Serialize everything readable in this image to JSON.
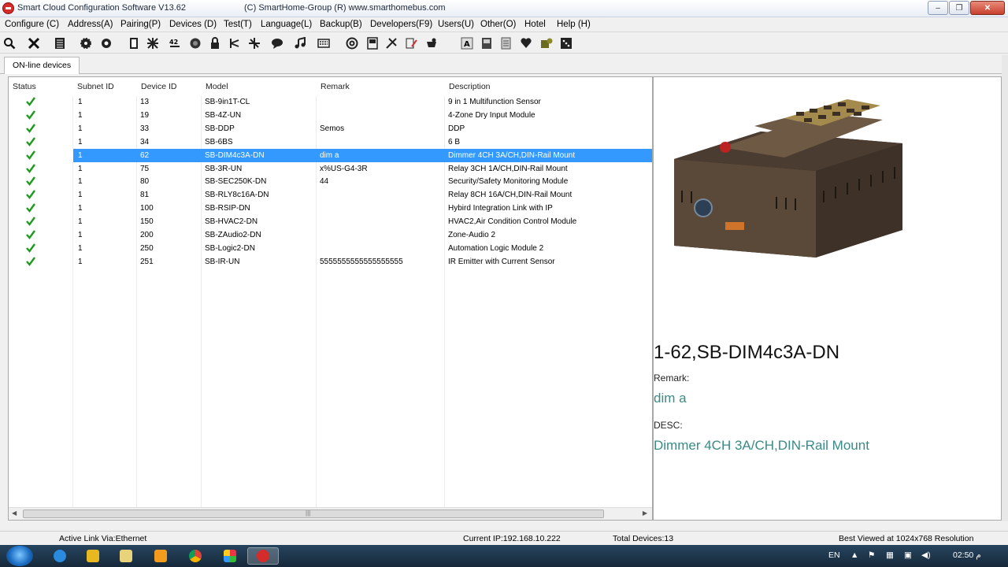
{
  "window": {
    "title": "Smart Cloud Configuration Software V13.62",
    "copyright": "(C) SmartHome-Group (R) www.smarthomebus.com",
    "minimize": "‒",
    "maximize": "❐",
    "close": "✕"
  },
  "menu": [
    {
      "label": "Configure (C)"
    },
    {
      "label": "Address(A)"
    },
    {
      "label": "Pairing(P)"
    },
    {
      "label": "Devices (D)"
    },
    {
      "label": "Test(T)"
    },
    {
      "label": "Language(L)"
    },
    {
      "label": "Backup(B)"
    },
    {
      "label": "Developers(F9)"
    },
    {
      "label": "Users(U)"
    },
    {
      "label": "Other(O)"
    },
    {
      "label": "Hotel"
    },
    {
      "label": "Help (H)"
    }
  ],
  "toolbar_icons": [
    "search-icon",
    "close-icon",
    "list-icon",
    "gear-icon",
    "target-icon",
    "book-icon",
    "tools-icon",
    "sort-icon",
    "record-icon",
    "lock-icon",
    "network-icon",
    "network-icon",
    "chat-icon",
    "music-icon",
    "keyboard-icon",
    "at-icon",
    "panel-icon",
    "plug-icon",
    "edit-icon",
    "settings-icon",
    "text-icon",
    "save-icon",
    "document-icon",
    "heart-icon",
    "weight-icon",
    "dice-icon"
  ],
  "tabs": [
    {
      "label": "ON-line devices"
    }
  ],
  "grid": {
    "columns": [
      "Status",
      "Subnet ID",
      "Device ID",
      "Model",
      "Remark",
      "Description"
    ],
    "rows": [
      {
        "subnet": "1",
        "device": "13",
        "model": "SB-9in1T-CL",
        "remark": "",
        "desc": "9 in 1 Multifunction Sensor"
      },
      {
        "subnet": "1",
        "device": "19",
        "model": "SB-4Z-UN",
        "remark": "",
        "desc": "4-Zone Dry Input Module"
      },
      {
        "subnet": "1",
        "device": "33",
        "model": "SB-DDP",
        "remark": "Semos",
        "desc": "DDP"
      },
      {
        "subnet": "1",
        "device": "34",
        "model": "SB-6BS",
        "remark": "",
        "desc": "6 B"
      },
      {
        "subnet": "1",
        "device": "62",
        "model": "SB-DIM4c3A-DN",
        "remark": "dim a",
        "desc": "Dimmer 4CH 3A/CH,DIN-Rail Mount"
      },
      {
        "subnet": "1",
        "device": "75",
        "model": "SB-3R-UN",
        "remark": "x%US-G4-3R",
        "desc": "Relay 3CH 1A/CH,DIN-Rail Mount"
      },
      {
        "subnet": "1",
        "device": "80",
        "model": "SB-SEC250K-DN",
        "remark": "44",
        "desc": "Security/Safety Monitoring Module"
      },
      {
        "subnet": "1",
        "device": "81",
        "model": "SB-RLY8c16A-DN",
        "remark": "",
        "desc": "Relay 8CH 16A/CH,DIN-Rail Mount"
      },
      {
        "subnet": "1",
        "device": "100",
        "model": "SB-RSIP-DN",
        "remark": "",
        "desc": "Hybird Integration Link with IP"
      },
      {
        "subnet": "1",
        "device": "150",
        "model": "SB-HVAC2-DN",
        "remark": "",
        "desc": "HVAC2,Air Condition Control Module"
      },
      {
        "subnet": "1",
        "device": "200",
        "model": "SB-ZAudio2-DN",
        "remark": "",
        "desc": "Zone-Audio 2"
      },
      {
        "subnet": "1",
        "device": "250",
        "model": "SB-Logic2-DN",
        "remark": "",
        "desc": "Automation Logic Module 2"
      },
      {
        "subnet": "1",
        "device": "251",
        "model": "SB-IR-UN",
        "remark": "5555555555555555555",
        "desc": "IR Emitter with Current Sensor"
      }
    ],
    "selected_row": 4,
    "scroll_left": "◀",
    "scroll_right": "▶",
    "scroll_grip": "|||"
  },
  "detail": {
    "title": "1-62,SB-DIM4c3A-DN",
    "remark_label": "Remark:",
    "remark_value": "dim a",
    "desc_label": "DESC:",
    "desc_value": "Dimmer 4CH 3A/CH,DIN-Rail Mount"
  },
  "status": {
    "link": "Active Link Via:Ethernet",
    "ip": "Current IP:192.168.10.222",
    "total": "Total Devices:13",
    "best": "Best Viewed at 1024x768 Resolution"
  },
  "taskbar": {
    "lang": "EN",
    "time": "02:50 م"
  },
  "colors": {
    "selection": "#3399ff",
    "check": "#1e9a1e",
    "detail_value": "#3a8a86"
  }
}
